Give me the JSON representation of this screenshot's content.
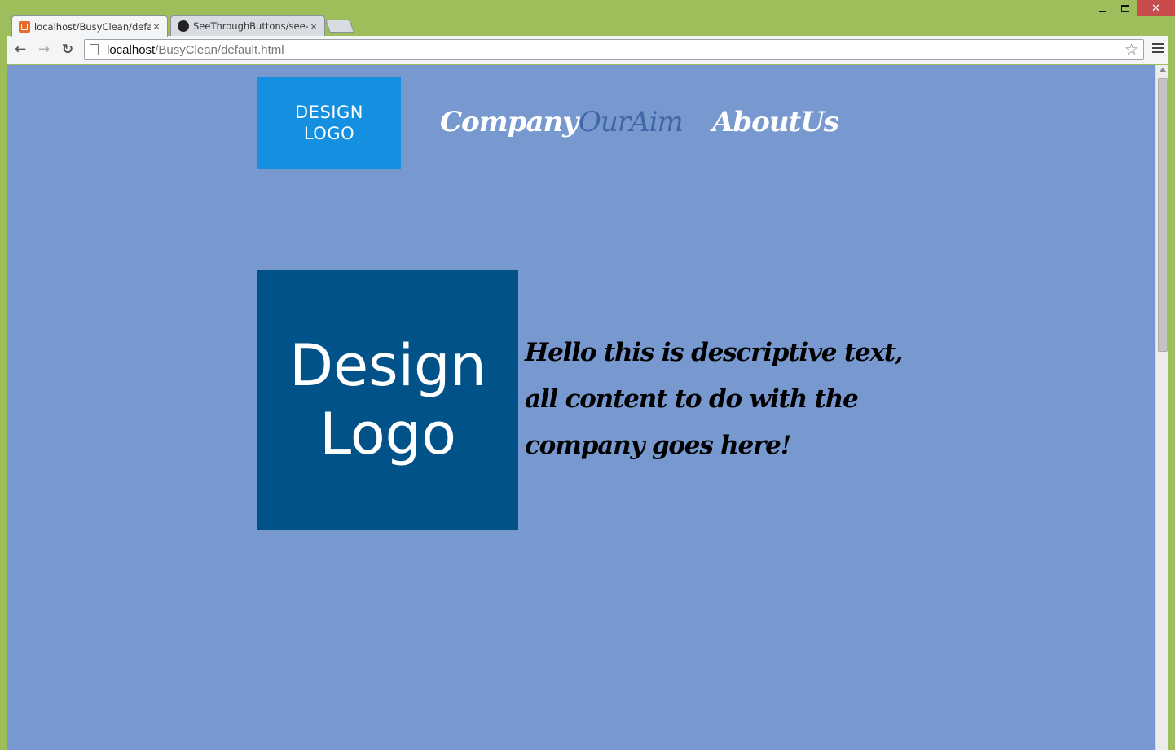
{
  "browser": {
    "tabs": [
      {
        "title": "localhost/BusyClean/defa",
        "active": true,
        "icon": "xampp-icon"
      },
      {
        "title": "SeeThroughButtons/see-t",
        "active": false,
        "icon": "github-icon"
      }
    ],
    "close_glyph": "×",
    "url_host": "localhost",
    "url_path": "/BusyClean/default.html"
  },
  "site": {
    "header_logo": "DESIGN LOGO",
    "nav": [
      {
        "label": "Company",
        "current": false
      },
      {
        "label": "OurAim",
        "current": true
      },
      {
        "label": "AboutUs",
        "current": false
      }
    ],
    "main_logo": "Design Logo",
    "description": "Hello this is descriptive text, all content to do with the company goes here!"
  },
  "colors": {
    "page_background": "#7899cf",
    "header_logo_bg": "#1590e0",
    "main_logo_bg": "#015289",
    "nav_current": "#3f66a6"
  }
}
